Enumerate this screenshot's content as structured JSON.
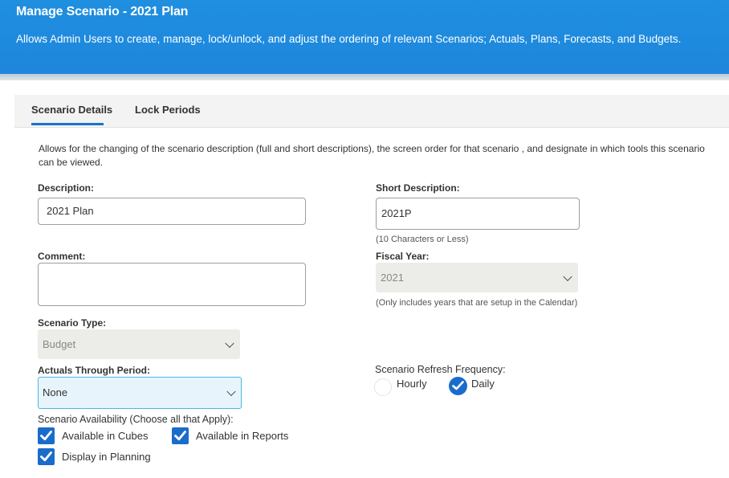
{
  "header": {
    "title": "Manage Scenario - 2021 Plan",
    "description": "Allows Admin Users to create, manage, lock/unlock, and adjust the ordering of relevant Scenarios; Actuals, Plans, Forecasts, and Budgets."
  },
  "tabs": [
    {
      "label": "Scenario Details",
      "active": true
    },
    {
      "label": "Lock Periods",
      "active": false
    }
  ],
  "intro": "Allows for the changing of the scenario description (full and short descriptions), the screen order for that scenario , and designate in which tools this scenario can be viewed.",
  "form": {
    "description": {
      "label": "Description:",
      "value": "2021 Plan"
    },
    "short_description": {
      "label": "Short Description:",
      "value": "2021P",
      "hint": "(10 Characters or Less)"
    },
    "comment": {
      "label": "Comment:",
      "value": ""
    },
    "fiscal_year": {
      "label": "Fiscal Year:",
      "value": "2021",
      "hint": "(Only includes years that are setup in the Calendar)"
    },
    "scenario_type": {
      "label": "Scenario Type:",
      "value": "Budget"
    },
    "actuals_through_period": {
      "label": "Actuals Through Period:",
      "value": "None"
    },
    "refresh_frequency": {
      "label": "Scenario Refresh Frequency:",
      "options": [
        {
          "label": "Hourly",
          "selected": false
        },
        {
          "label": "Daily",
          "selected": true
        }
      ]
    },
    "availability": {
      "label": "Scenario Availability (Choose all that Apply):",
      "options": [
        {
          "label": "Available in Cubes",
          "checked": true
        },
        {
          "label": "Available in Reports",
          "checked": true
        },
        {
          "label": "Display in Planning",
          "checked": true
        }
      ]
    }
  },
  "colors": {
    "header_blue": "#1f8fe0",
    "accent_blue": "#1a6ccc",
    "active_select_border": "#4cb6e5"
  },
  "icons": {
    "select_arrow": "chevron-down-icon",
    "checkbox": "checkmark-icon"
  }
}
